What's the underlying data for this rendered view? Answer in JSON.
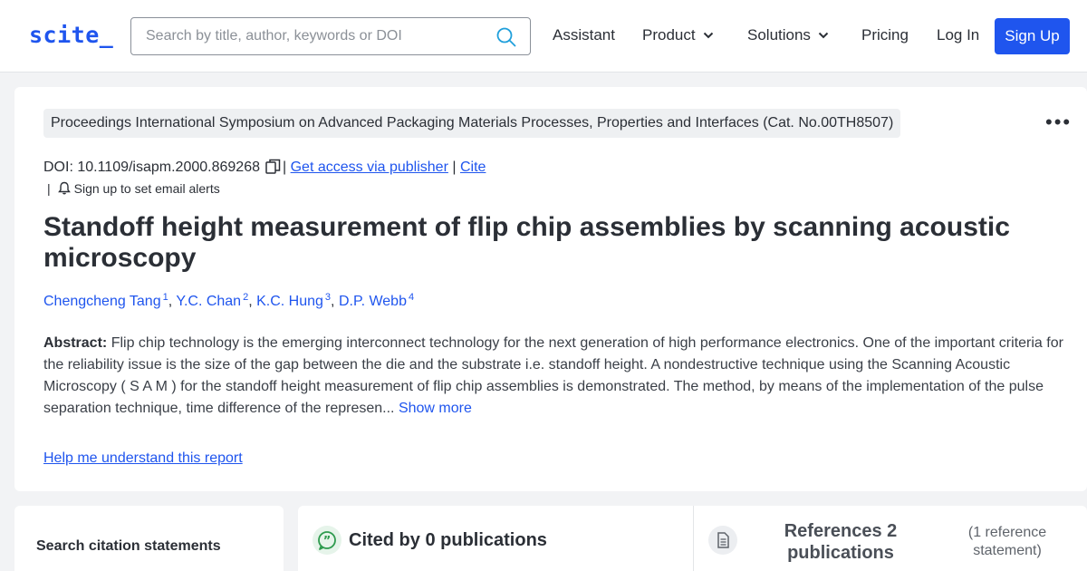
{
  "header": {
    "logo": "scite_",
    "search_placeholder": "Search by title, author, keywords or DOI",
    "nav": {
      "assistant": "Assistant",
      "product": "Product",
      "solutions": "Solutions",
      "pricing": "Pricing",
      "login": "Log In",
      "signup": "Sign Up"
    }
  },
  "paper": {
    "venue": "Proceedings International Symposium on Advanced Packaging Materials Processes, Properties and Interfaces (Cat. No.00TH8507)",
    "doi_label": "DOI: 10.1109/isapm.2000.869268",
    "get_access": "Get access via publisher",
    "cite": "Cite",
    "pipe": "|",
    "email_alert": "Sign up to set email alerts",
    "title": "Standoff height measurement of flip chip assemblies by scanning acoustic microscopy",
    "authors": [
      {
        "name": "Chengcheng Tang",
        "sup": "1"
      },
      {
        "name": "Y.C. Chan",
        "sup": "2"
      },
      {
        "name": "K.C. Hung",
        "sup": "3"
      },
      {
        "name": "D.P. Webb",
        "sup": "4"
      }
    ],
    "author_separator": ",",
    "abstract_label": "Abstract:",
    "abstract_text": "Flip chip technology is the emerging interconnect technology for the next generation of high performance electronics. One of the important criteria for the reliability issue is the size of the gap between the die and the substrate i.e. standoff height. A nondestructive technique using the Scanning Acoustic Microscopy ( S A M ) for the standoff height measurement of flip chip assemblies is demonstrated. The method, by means of the implementation of the pulse separation technique, time difference of the represen...",
    "show_more": "Show more",
    "help_link": "Help me understand this report"
  },
  "panels": {
    "search_statements": "Search citation statements",
    "cited_by": "Cited by 0 publications",
    "references": "References 2 publications",
    "reference_statement": "(1 reference statement)"
  },
  "colors": {
    "accent": "#1f55ee",
    "cited_icon": "#2e9b4e"
  }
}
